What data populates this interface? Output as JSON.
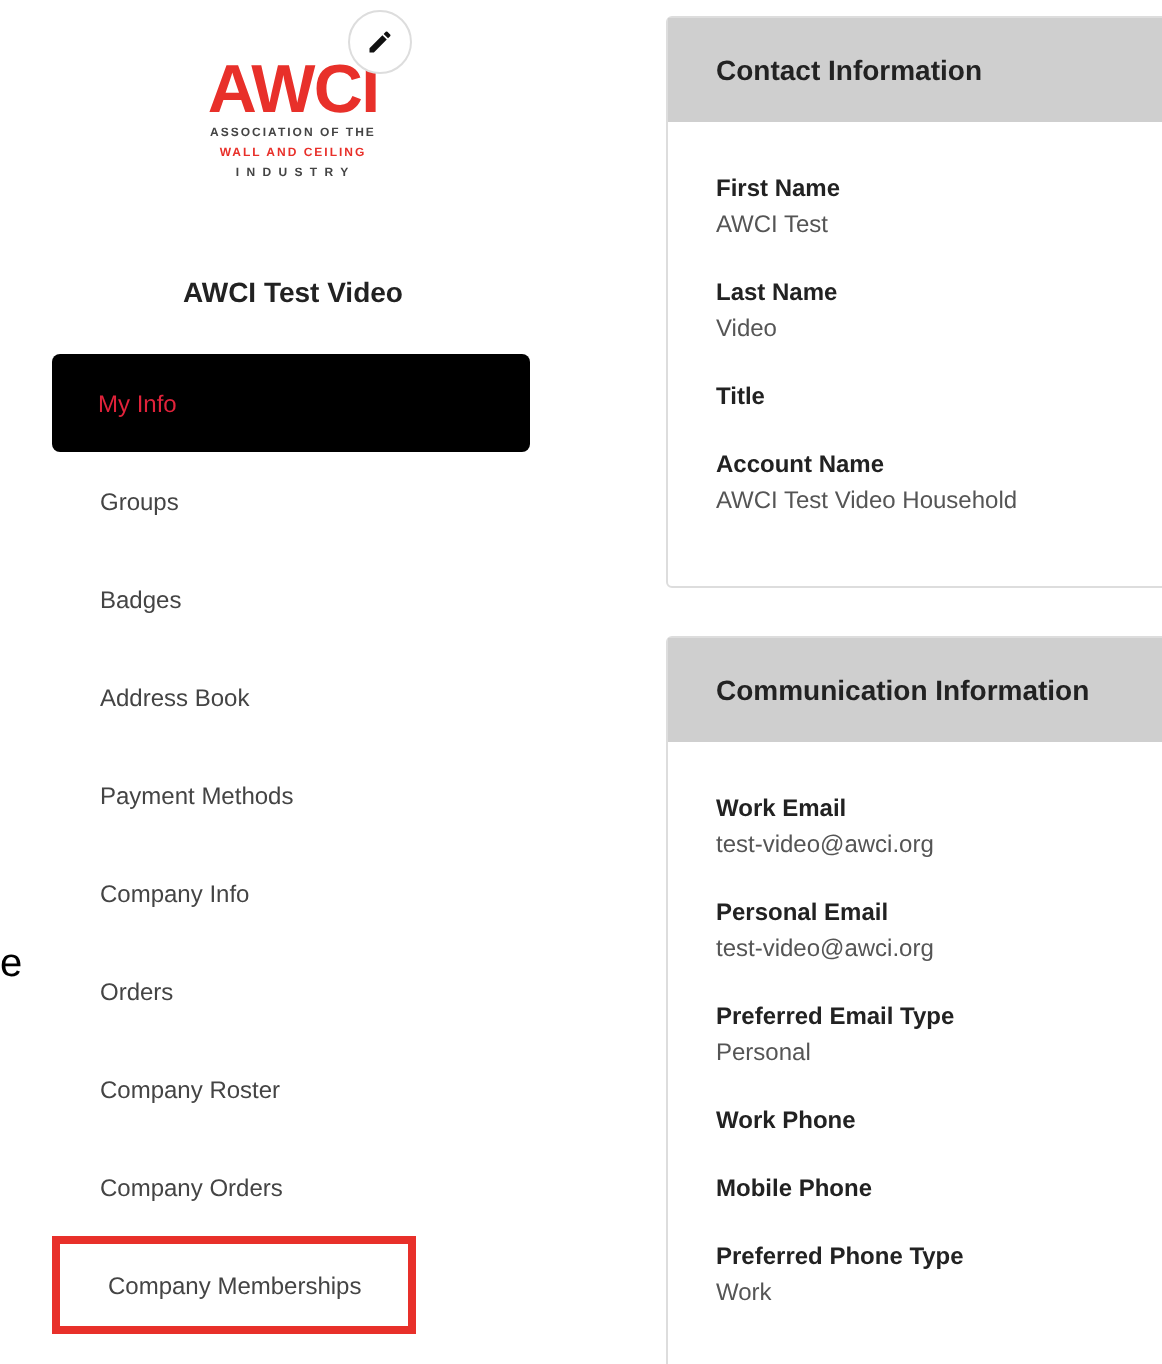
{
  "logo": {
    "wordmark": "AWCI",
    "lines": [
      "ASSOCIATION OF THE",
      "WALL AND CEILING",
      "I N D U S T R Y"
    ]
  },
  "profile_name": "AWCI Test Video",
  "nav": [
    {
      "label": "My Info",
      "selected": true,
      "highlighted": false
    },
    {
      "label": "Groups",
      "selected": false,
      "highlighted": false
    },
    {
      "label": "Badges",
      "selected": false,
      "highlighted": false
    },
    {
      "label": "Address Book",
      "selected": false,
      "highlighted": false
    },
    {
      "label": "Payment Methods",
      "selected": false,
      "highlighted": false
    },
    {
      "label": "Company Info",
      "selected": false,
      "highlighted": false
    },
    {
      "label": "Orders",
      "selected": false,
      "highlighted": false
    },
    {
      "label": "Company Roster",
      "selected": false,
      "highlighted": false
    },
    {
      "label": "Company Orders",
      "selected": false,
      "highlighted": false
    },
    {
      "label": "Company Memberships",
      "selected": false,
      "highlighted": true
    }
  ],
  "overlay_text": "e",
  "panels": [
    {
      "title": "Contact Information",
      "fields": [
        {
          "label": "First Name",
          "value": "AWCI Test"
        },
        {
          "label": "Last Name",
          "value": "Video"
        },
        {
          "label": "Title"
        },
        {
          "label": "Account Name",
          "value": "AWCI Test Video Household"
        }
      ]
    },
    {
      "title": "Communication Information",
      "fields": [
        {
          "label": "Work Email",
          "value": "test-video@awci.org"
        },
        {
          "label": "Personal Email",
          "value": "test-video@awci.org"
        },
        {
          "label": "Preferred Email Type",
          "value": "Personal"
        },
        {
          "label": "Work Phone"
        },
        {
          "label": "Mobile Phone"
        },
        {
          "label": "Preferred Phone Type",
          "value": "Work"
        }
      ]
    }
  ]
}
